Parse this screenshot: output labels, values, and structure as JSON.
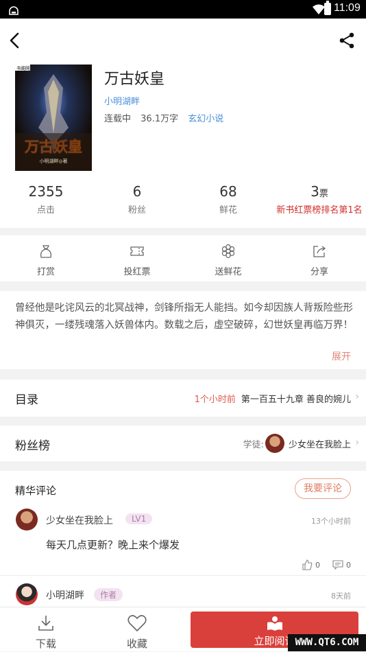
{
  "status_bar": {
    "time": "11:09"
  },
  "book": {
    "title": "万古妖皇",
    "author": "小明湖畔",
    "status": "连载中",
    "word_count": "36.1万字",
    "genre": "玄幻小说",
    "cover": {
      "badge": "书阁网",
      "title_art": "万古妖皇",
      "credit": "小明湖畔◎著"
    }
  },
  "stats": [
    {
      "value": "2355",
      "label": "点击"
    },
    {
      "value": "6",
      "label": "粉丝"
    },
    {
      "value": "68",
      "label": "鲜花"
    },
    {
      "value": "3",
      "unit": "票",
      "label": "新书红票榜排名第1名"
    }
  ],
  "actions": [
    {
      "label": "打赏",
      "icon": "reward-icon"
    },
    {
      "label": "投红票",
      "icon": "ticket-icon"
    },
    {
      "label": "送鲜花",
      "icon": "flower-icon"
    },
    {
      "label": "分享",
      "icon": "share-out-icon"
    }
  ],
  "intro": {
    "text": "曾经他是叱诧风云的北冥战神，剑锋所指无人能挡。如今却因族人背叛险些形神俱灭，一缕残魂落入妖兽体内。数载之后，虚空破碎，幻世妖皇再临万界！",
    "expand_label": "展开"
  },
  "toc": {
    "title": "目录",
    "updated": "1个小时前",
    "latest_chapter": "第一百五十九章 善良的婉儿"
  },
  "fans": {
    "title": "粉丝榜",
    "prefix": "学徒:",
    "top_fan": "少女坐在我脸上"
  },
  "comments": {
    "title": "精华评论",
    "write_label": "我要评论",
    "items": [
      {
        "user": "少女坐在我脸上",
        "tag": "LV1",
        "time": "13个小时前",
        "text": "每天几点更新？晚上来个爆发",
        "likes": "0",
        "replies": "0"
      },
      {
        "user": "小明湖畔",
        "tag": "作者",
        "time": "8天前"
      }
    ]
  },
  "bottom_bar": {
    "download": "下载",
    "favorite": "收藏",
    "read_now": "立即阅读"
  },
  "watermark": "WWW.QT6.COM",
  "colors": {
    "accent_red": "#d9403b",
    "link_blue": "#4a90d9"
  }
}
